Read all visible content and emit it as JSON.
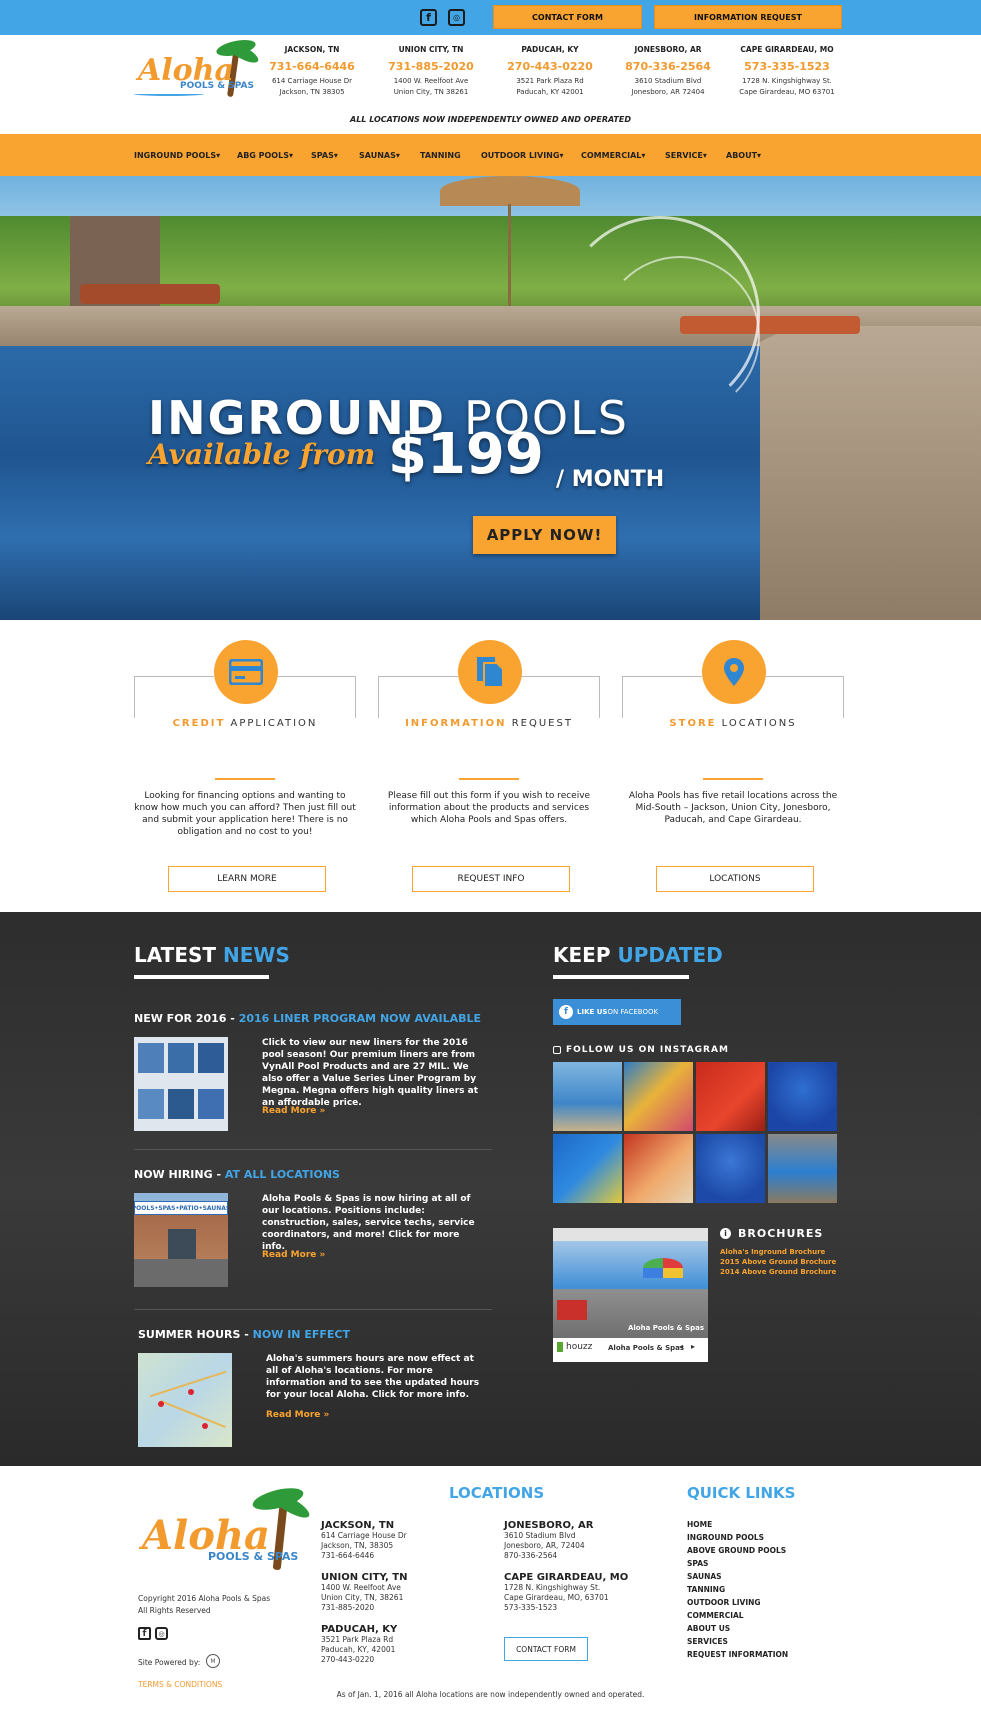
{
  "topbar": {
    "contact_label": "CONTACT FORM",
    "info_label": "INFORMATION REQUEST"
  },
  "logo": {
    "word": "Aloha",
    "sub": "POOLS & SPAS"
  },
  "locations": [
    {
      "city": "JACKSON, TN",
      "phone": "731-664-6446",
      "addr1": "614 Carriage House Dr",
      "addr2": "Jackson, TN 38305"
    },
    {
      "city": "UNION CITY, TN",
      "phone": "731-885-2020",
      "addr1": "1400 W. Reelfoot Ave",
      "addr2": "Union City, TN 38261"
    },
    {
      "city": "PADUCAH, KY",
      "phone": "270-443-0220",
      "addr1": "3521 Park Plaza Rd",
      "addr2": "Paducah, KY 42001"
    },
    {
      "city": "JONESBORO, AR",
      "phone": "870-336-2564",
      "addr1": "3610 Stadium Blvd",
      "addr2": "Jonesboro, AR 72404"
    },
    {
      "city": "CAPE GIRARDEAU, MO",
      "phone": "573-335-1523",
      "addr1": "1728 N. Kingshighway St.",
      "addr2": "Cape Girardeau, MO 63701"
    }
  ],
  "independent_note": "ALL LOCATIONS NOW INDEPENDENTLY OWNED AND OPERATED",
  "nav": [
    "INGROUND POOLS▾",
    "ABG POOLS▾",
    "SPAS▾",
    "SAUNAS▾",
    "TANNING",
    "OUTDOOR LIVING▾",
    "COMMERCIAL▾",
    "SERVICE▾",
    "ABOUT▾"
  ],
  "hero": {
    "title_bold": "INGROUND",
    "title_thin": "POOLS",
    "script": "Available from",
    "price": "$199",
    "per": "/ MONTH",
    "cta": "APPLY NOW!"
  },
  "features": [
    {
      "hl": "CREDIT",
      "rest": "APPLICATION",
      "text": "Looking for financing options and wanting to know how much you can afford? Then just fill out and submit your application here! There is no obligation and no cost to you!",
      "button": "LEARN MORE",
      "icon": "credit-card-icon"
    },
    {
      "hl": "INFORMATION",
      "rest": "REQUEST",
      "text": "Please fill out this form if you wish to receive information about the products and services which Aloha Pools and Spas offers.",
      "button": "REQUEST INFO",
      "icon": "documents-icon"
    },
    {
      "hl": "STORE",
      "rest": "LOCATIONS",
      "text": "Aloha Pools has five retail locations across the Mid-South – Jackson, Union City, Jonesboro, Paducah, and Cape Girardeau.",
      "button": "LOCATIONS",
      "icon": "map-pin-icon"
    }
  ],
  "news": {
    "heading_a": "LATEST",
    "heading_b": "NEWS",
    "items": [
      {
        "title_a": "NEW FOR 2016 - ",
        "title_b": "2016 LINER PROGRAM NOW AVAILABLE",
        "text": "Click to view our new liners for the 2016 pool season! Our premium liners are from VynAll Pool Products and are 27 MIL. We also offer a Value Series Liner Program by Megna. Megna offers high quality liners at an affordable price.",
        "more": "Read More »"
      },
      {
        "title_a": "NOW HIRING - ",
        "title_b": "AT ALL LOCATIONS",
        "text": "Aloha Pools & Spas is now hiring at all of our locations. Positions include: construction, sales, service techs, service coordinators, and more! Click for more info.",
        "more": "Read More »",
        "sign": "POOLS•SPAS•PATIO•SAUNAS"
      },
      {
        "title_a": "SUMMER HOURS - ",
        "title_b": "NOW IN EFFECT",
        "text": "Aloha's summers hours are now effect at all of Aloha's locations. For more information and to see the updated hours for your local Aloha. Click for more info.",
        "more": "Read More »"
      }
    ]
  },
  "updates": {
    "heading_a": "KEEP",
    "heading_b": "UPDATED",
    "fb_a": "LIKE US",
    "fb_b": " ON FACEBOOK",
    "instagram": "FOLLOW US ON INSTAGRAM",
    "brochures": "BROCHURES",
    "brochure_links": [
      "Aloha's Inground Brochure",
      "2015 Above Ground Brochure",
      "2014 Above Ground Brochure"
    ],
    "houzz_caption": "Aloha Pools & Spas",
    "houzz_brand": "houzz",
    "houzz_name": "Aloha Pools & Spas"
  },
  "footer": {
    "copyright": "Copyright 2016 Aloha Pools & Spas",
    "rights": "All Rights Reserved",
    "powered": "Site Powered by:",
    "terms": "TERMS & CONDITIONS",
    "locations_heading": "LOCATIONS",
    "quick_heading": "QUICK LINKS",
    "locations": [
      {
        "city": "JACKSON, TN",
        "l1": "614 Carriage House Dr",
        "l2": "Jackson, TN, 38305",
        "l3": "731-664-6446"
      },
      {
        "city": "UNION CITY, TN",
        "l1": "1400 W. Reelfoot Ave",
        "l2": "Union City, TN, 38261",
        "l3": "731-885-2020"
      },
      {
        "city": "PADUCAH, KY",
        "l1": "3521 Park Plaza Rd",
        "l2": "Paducah, KY, 42001",
        "l3": "270-443-0220"
      },
      {
        "city": "JONESBORO, AR",
        "l1": "3610 Stadium Blvd",
        "l2": "Jonesboro, AR, 72404",
        "l3": "870-336-2564"
      },
      {
        "city": "CAPE GIRARDEAU, MO",
        "l1": "1728 N. Kingshighway St.",
        "l2": "Cape Girardeau, MO, 63701",
        "l3": "573-335-1523"
      }
    ],
    "contact_btn": "CONTACT FORM",
    "quick_links": [
      "HOME",
      "INGROUND POOLS",
      "ABOVE GROUND POOLS",
      "SPAS",
      "SAUNAS",
      "TANNING",
      "OUTDOOR LIVING",
      "COMMERCIAL",
      "ABOUT US",
      "SERVICES",
      "REQUEST INFORMATION"
    ],
    "bottom_note": "As of Jan. 1, 2016 all Aloha locations are now independently owned and operated."
  },
  "colors": {
    "orange": "#f9a330",
    "blue": "#42a5e6",
    "dark": "#2d2d2d"
  }
}
